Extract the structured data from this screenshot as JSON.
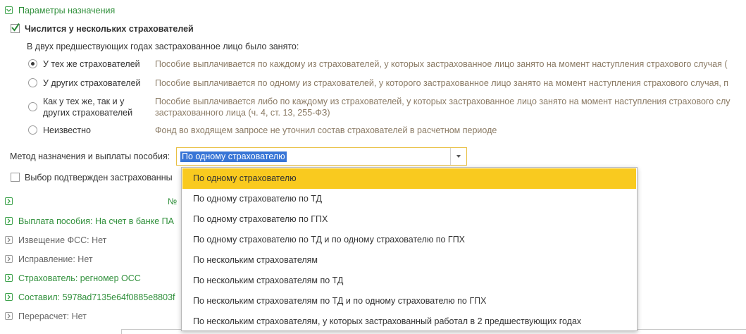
{
  "section_header": "Параметры назначения",
  "multiple_insurers": {
    "label": "Числится у нескольких страхователей",
    "checked": true
  },
  "prev_years_caption": "В двух предшествующих годах застрахованное лицо было занято:",
  "options": [
    {
      "label": "У тех же страхователей",
      "desc": "Пособие выплачивается по каждому из страхователей, у которых застрахованное лицо занято на момент наступления страхового случая (",
      "selected": true
    },
    {
      "label": "У других страхователей",
      "desc": "Пособие выплачивается по одному из страхователей, у которого застрахованное лицо занято на момент наступления страхового случая, п",
      "selected": false
    },
    {
      "label_line1": "Как у тех же, так и у",
      "label_line2": "других страхователей",
      "desc_line1": "Пособие выплачивается либо по каждому из страхователей, у которых застрахованное лицо занято на момент наступления страхового слу",
      "desc_line2": "застрахованного лица (ч. 4, ст. 13, 255-ФЗ)",
      "selected": false
    },
    {
      "label": "Неизвестно",
      "desc": "Фонд во входящем запросе не уточнил состав страхователей в расчетном периоде",
      "selected": false
    }
  ],
  "method": {
    "label": "Метод назначения и выплаты пособия:",
    "value": "По одному страхователю"
  },
  "confirm": {
    "label": "Выбор подтвержден застрахованны",
    "checked": false
  },
  "number_fragment": "№",
  "payment": "Выплата пособия: На счет в банке ПА",
  "fss_notice": "Извещение ФСС: Нет",
  "correction": "Исправление: Нет",
  "insurer": "Страхователь: регномер ОСС",
  "author": "Составил: 5978ad7135e64f0885e8803f",
  "recalc": "Перерасчет: Нет",
  "dropdown_items": [
    "По одному страхователю",
    "По одному страхователю по ТД",
    "По одному страхователю по ГПХ",
    "По одному страхователю по ТД и по одному страхователю по ГПХ",
    "По нескольким страхователям",
    "По нескольким страхователям по ТД",
    "По нескольким страхователям по ТД и по одному страхователю по ГПХ",
    "По нескольким страхователям, у которых застрахованный работал в 2 предшествующих годах"
  ],
  "dropdown_selected_index": 0,
  "colors": {
    "section_green": "#2f8f3a",
    "highlight_yellow": "#f9ca1f",
    "selection_blue": "#3875d6",
    "focus_border": "#e8c043"
  }
}
